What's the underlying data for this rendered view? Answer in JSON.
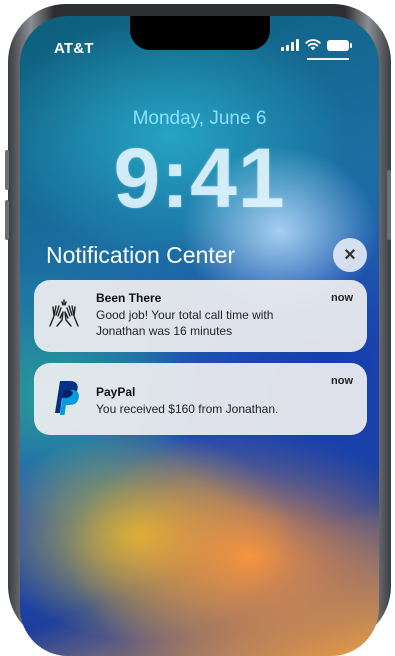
{
  "status_bar": {
    "carrier": "AT&T",
    "signal_icon": "cellular-signal-icon",
    "wifi_icon": "wifi-icon",
    "battery_icon": "battery-icon"
  },
  "lock_screen": {
    "date": "Monday, June 6",
    "time": "9:41"
  },
  "notification_center": {
    "title": "Notification Center",
    "close_icon": "close-icon",
    "close_glyph": "×"
  },
  "notifications": [
    {
      "app": "Been There",
      "icon": "high-five-hands-icon",
      "message": "Good job! Your total call time with Jonathan was 16 minutes",
      "time": "now"
    },
    {
      "app": "PayPal",
      "icon": "paypal-logo-icon",
      "message": "You received $160 from Jonathan.",
      "time": "now"
    }
  ],
  "colors": {
    "date_text": "#8de0ff",
    "card_background": "#eeeef0",
    "paypal_dark_blue": "#003087",
    "paypal_light_blue": "#009cde"
  }
}
